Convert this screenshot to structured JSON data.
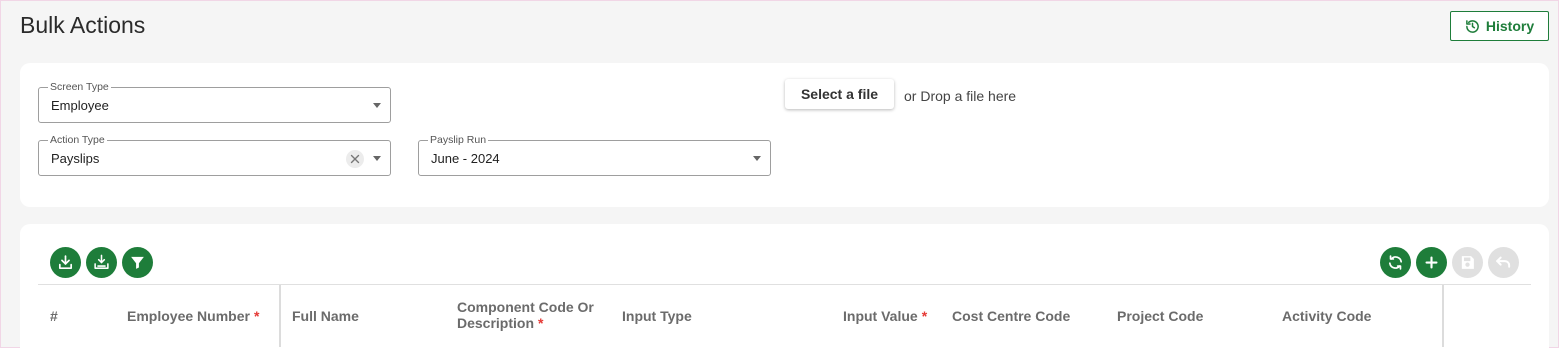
{
  "page": {
    "title": "Bulk Actions",
    "history_label": "History"
  },
  "filters": {
    "screen_type": {
      "label": "Screen Type",
      "value": "Employee"
    },
    "action_type": {
      "label": "Action Type",
      "value": "Payslips"
    },
    "payslip_run": {
      "label": "Payslip Run",
      "value": "June - 2024"
    },
    "select_file_label": "Select a file",
    "drop_text": "or Drop a file here"
  },
  "toolbar": {
    "left_icons": [
      "download-icon",
      "download-template-icon",
      "filter-icon"
    ],
    "right_icons": [
      "refresh-icon",
      "add-icon",
      "save-icon",
      "undo-icon"
    ],
    "save_enabled": false,
    "undo_enabled": false
  },
  "table": {
    "columns": [
      {
        "label": "#",
        "required": false
      },
      {
        "label": "Employee Number",
        "required": true
      },
      {
        "label": "Full Name",
        "required": false
      },
      {
        "label": "Component Code Or",
        "label2": "Description",
        "required": true
      },
      {
        "label": "Input Type",
        "required": false
      },
      {
        "label": "Input Value",
        "required": true
      },
      {
        "label": "Cost Centre Code",
        "required": false
      },
      {
        "label": "Project Code",
        "required": false
      },
      {
        "label": "Activity Code",
        "required": false
      }
    ],
    "required_marker": "*"
  },
  "colors": {
    "primary": "#1e7d3a",
    "required": "#e53935",
    "disabled": "#e0e0e0"
  }
}
